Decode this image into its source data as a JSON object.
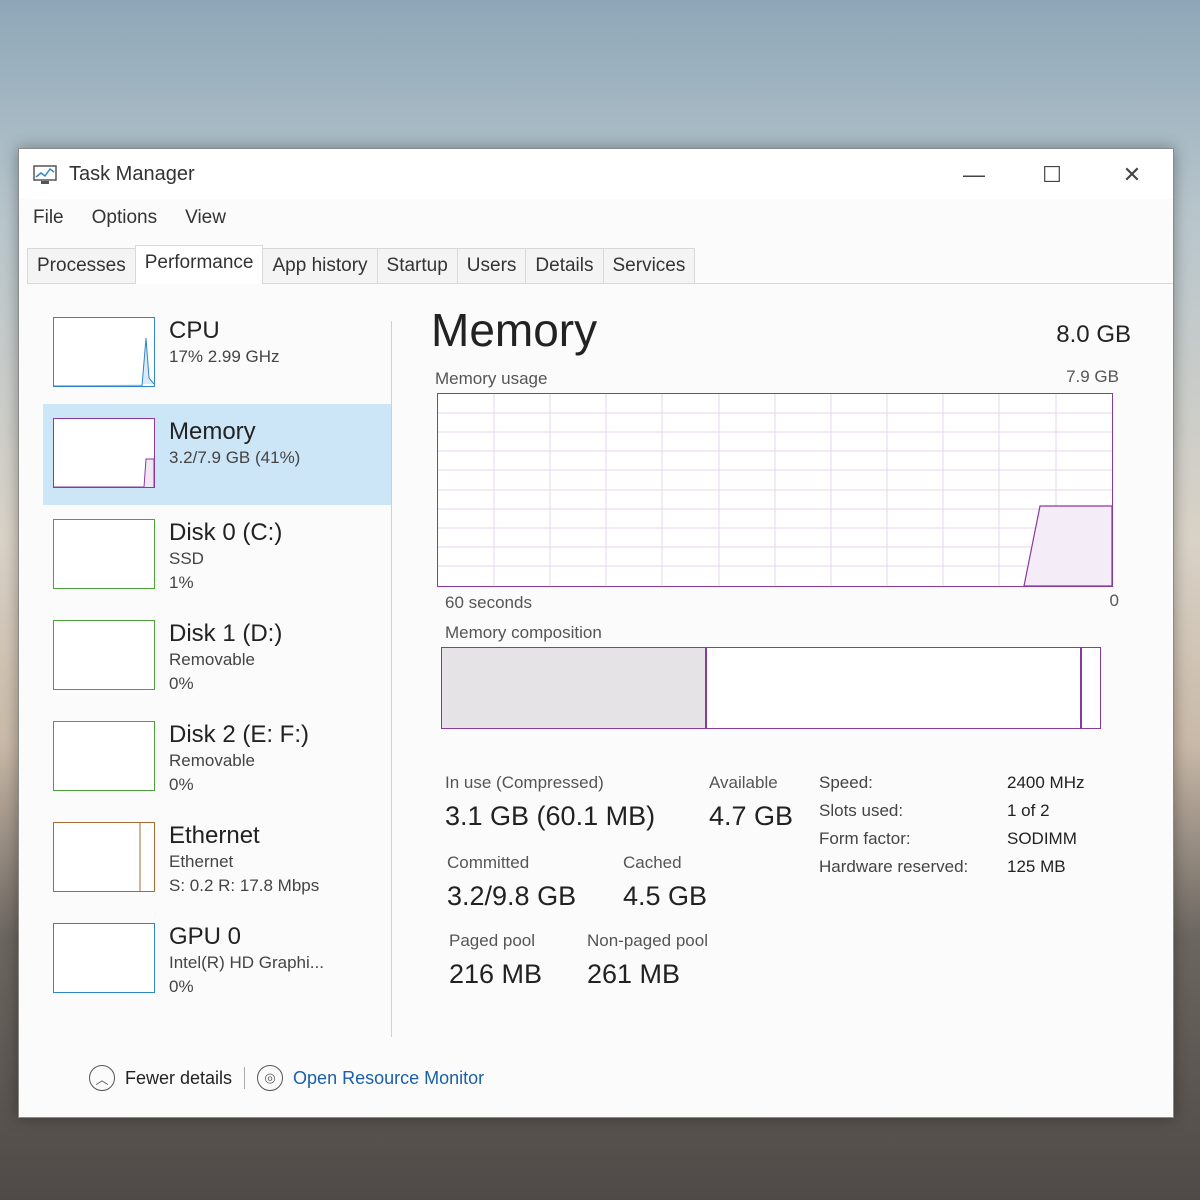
{
  "window": {
    "title": "Task Manager",
    "controls": {
      "minimize": "—",
      "maximize": "☐",
      "close": "✕"
    }
  },
  "menu": [
    "File",
    "Options",
    "View"
  ],
  "tabs": [
    {
      "label": "Processes",
      "active": false
    },
    {
      "label": "Performance",
      "active": true
    },
    {
      "label": "App history",
      "active": false
    },
    {
      "label": "Startup",
      "active": false
    },
    {
      "label": "Users",
      "active": false
    },
    {
      "label": "Details",
      "active": false
    },
    {
      "label": "Services",
      "active": false
    }
  ],
  "resources": [
    {
      "name": "CPU",
      "line1": "17% 2.99 GHz",
      "line2": ""
    },
    {
      "name": "Memory",
      "line1": "3.2/7.9 GB (41%)",
      "line2": ""
    },
    {
      "name": "Disk 0 (C:)",
      "line1": "SSD",
      "line2": "1%"
    },
    {
      "name": "Disk 1 (D:)",
      "line1": "Removable",
      "line2": "0%"
    },
    {
      "name": "Disk 2 (E: F:)",
      "line1": "Removable",
      "line2": "0%"
    },
    {
      "name": "Ethernet",
      "line1": "Ethernet",
      "line2": "S: 0.2 R: 17.8 Mbps"
    },
    {
      "name": "GPU 0",
      "line1": "Intel(R) HD Graphi...",
      "line2": "0%"
    }
  ],
  "detail": {
    "title": "Memory",
    "total": "8.0 GB",
    "usage_label": "Memory usage",
    "usage_max": "7.9 GB",
    "time_span": "60 seconds",
    "zero": "0",
    "composition_label": "Memory composition",
    "composition_in_use_fraction": 0.4,
    "composition_standby_fraction": 0.57,
    "stats": {
      "in_use_label": "In use (Compressed)",
      "in_use_value": "3.1 GB (60.1 MB)",
      "available_label": "Available",
      "available_value": "4.7 GB",
      "committed_label": "Committed",
      "committed_value": "3.2/9.8 GB",
      "cached_label": "Cached",
      "cached_value": "4.5 GB",
      "paged_label": "Paged pool",
      "paged_value": "216 MB",
      "nonpaged_label": "Non-paged pool",
      "nonpaged_value": "261 MB"
    },
    "props": {
      "speed_label": "Speed:",
      "speed_value": "2400 MHz",
      "slots_label": "Slots used:",
      "slots_value": "1 of 2",
      "form_label": "Form factor:",
      "form_value": "SODIMM",
      "reserved_label": "Hardware reserved:",
      "reserved_value": "125 MB"
    }
  },
  "footer": {
    "fewer_details": "Fewer details",
    "resource_monitor": "Open Resource Monitor"
  },
  "colors": {
    "memory_accent": "#8a3a9c",
    "cpu_accent": "#2d86c4",
    "disk_accent": "#4aa339",
    "ethernet_accent": "#a66a32",
    "selected_bg": "#cde6f7"
  }
}
